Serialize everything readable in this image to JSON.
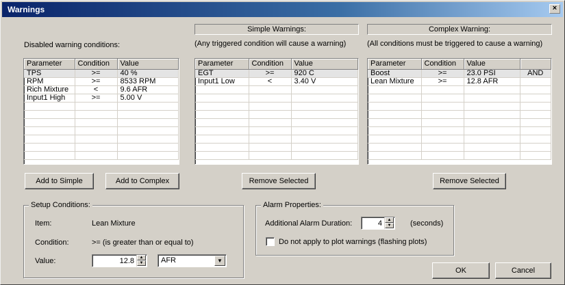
{
  "window": {
    "title": "Warnings",
    "close_glyph": "×"
  },
  "disabled": {
    "label": "Disabled warning conditions:",
    "columns": [
      "Parameter",
      "Condition",
      "Value"
    ],
    "rows": [
      [
        "TPS",
        ">=",
        "40 %"
      ],
      [
        "RPM",
        ">=",
        "8533 RPM"
      ],
      [
        "Rich Mixture",
        "<",
        "9.6 AFR"
      ],
      [
        "Input1 High",
        ">=",
        "5.00 V"
      ]
    ]
  },
  "simple": {
    "header": "Simple Warnings:",
    "subtitle": "(Any triggered condition will cause a warning)",
    "columns": [
      "Parameter",
      "Condition",
      "Value"
    ],
    "rows": [
      [
        "EGT",
        ">=",
        "920 C"
      ],
      [
        "Input1 Low",
        "<",
        "3.40 V"
      ]
    ]
  },
  "complex": {
    "header": "Complex Warning:",
    "subtitle": "(All conditions must be triggered to cause a warning)",
    "columns": [
      "Parameter",
      "Condition",
      "Value",
      ""
    ],
    "rows": [
      [
        "Boost",
        ">=",
        "23.0 PSI",
        "AND"
      ],
      [
        "Lean Mixture",
        ">=",
        "12.8 AFR",
        ""
      ]
    ]
  },
  "buttons": {
    "add_simple": "Add to Simple",
    "add_complex": "Add to Complex",
    "remove_simple": "Remove Selected",
    "remove_complex": "Remove Selected",
    "ok": "OK",
    "cancel": "Cancel"
  },
  "setup": {
    "legend": "Setup Conditions:",
    "item_label": "Item:",
    "item_value": "Lean Mixture",
    "condition_label": "Condition:",
    "condition_value": ">=  (is greater than or equal to)",
    "value_label": "Value:",
    "value": "12.8",
    "unit": "AFR"
  },
  "alarm": {
    "legend": "Alarm Properties:",
    "duration_label": "Additional Alarm Duration:",
    "duration_value": "4",
    "duration_unit": "(seconds)",
    "plot_checkbox_label": "Do not apply to plot warnings (flashing plots)",
    "plot_checkbox_checked": false
  },
  "icons": {
    "spin_up": "▲",
    "spin_down": "▼",
    "dropdown": "▼"
  }
}
